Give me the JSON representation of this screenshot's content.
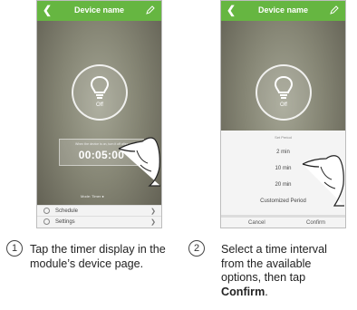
{
  "colors": {
    "accent": "#66b641",
    "text": "#222222"
  },
  "screen1": {
    "title": "Device name",
    "back_icon": "chevron-left-icon",
    "edit_icon": "pencil-icon",
    "bulb_status": "Off",
    "timer_note": "When the device is on, turn it off after",
    "timer_value": "00:05:00",
    "mode_text": "Mode: Timer",
    "menu": [
      {
        "label": "Schedule",
        "icon": "clock-icon"
      },
      {
        "label": "Settings",
        "icon": "gear-icon"
      }
    ]
  },
  "screen2": {
    "title": "Device name",
    "bulb_status": "Off",
    "sheet_title": "Set Period",
    "options": [
      "2 min",
      "10 min",
      "20 min",
      "Customized Period"
    ],
    "cancel_label": "Cancel",
    "confirm_label": "Confirm"
  },
  "steps": [
    {
      "number": "1",
      "text": "Tap the timer display in the module’s device page."
    },
    {
      "number": "2",
      "text_lines": [
        "Select a time interval",
        "from the available",
        "options, then tap"
      ],
      "bold": "Confirm",
      "suffix": "."
    }
  ]
}
